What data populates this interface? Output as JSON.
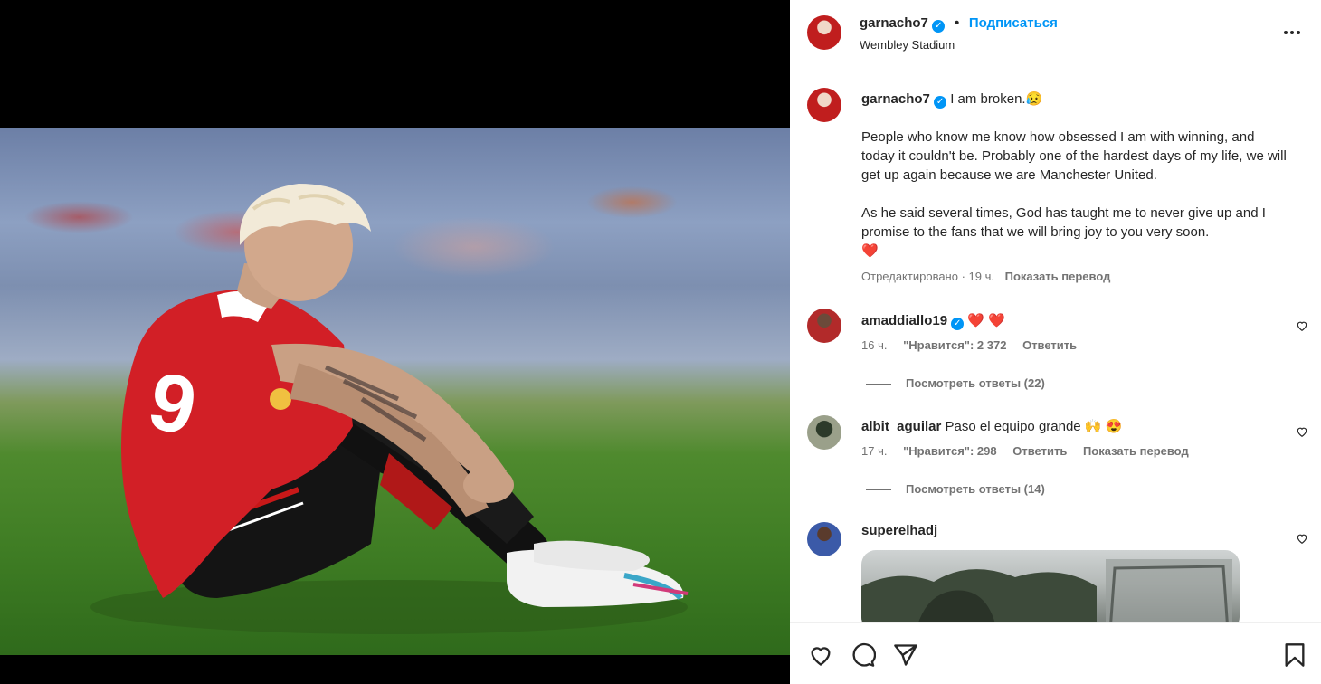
{
  "post": {
    "username": "garnacho7",
    "location": "Wembley Stadium",
    "follow_label": "Подписаться",
    "separator": "•",
    "more_icon": "more-horizontal-icon"
  },
  "caption": {
    "username": "garnacho7",
    "headline": "I am broken.😥",
    "paragraph1": "People who know me know how obsessed I am with winning, and today it couldn't be. Probably one of the hardest days of my life, we will get up again because we are Manchester United.",
    "paragraph2": "As he said several times, God has taught me to never give up and I promise to the fans that we will bring joy to you very soon.",
    "heart": "❤️",
    "edited": "Отредактировано · 19 ч.",
    "translate": "Показать перевод"
  },
  "comments": [
    {
      "username": "amaddiallo19",
      "verified": true,
      "text": "❤️ ❤️",
      "time": "16 ч.",
      "likes": "\"Нравится\": 2 372",
      "reply": "Ответить",
      "translate": "",
      "view_replies": "Посмотреть ответы (22)"
    },
    {
      "username": "albit_aguilar",
      "verified": false,
      "text": "Paso el equipo grande 🙌 😍",
      "time": "17 ч.",
      "likes": "\"Нравится\": 298",
      "reply": "Ответить",
      "translate": "Показать перевод",
      "view_replies": "Посмотреть ответы (14)"
    },
    {
      "username": "superelhadj",
      "verified": false,
      "text": "",
      "time": "",
      "likes": "",
      "reply": "",
      "translate": "",
      "view_replies": ""
    }
  ],
  "actions": {
    "like_icon": "heart-icon",
    "comment_icon": "comment-icon",
    "share_icon": "send-icon",
    "save_icon": "bookmark-icon"
  },
  "colors": {
    "accent": "#0095f6",
    "heart_red": "#ed1c24",
    "muted": "#737373",
    "text": "#262626"
  }
}
